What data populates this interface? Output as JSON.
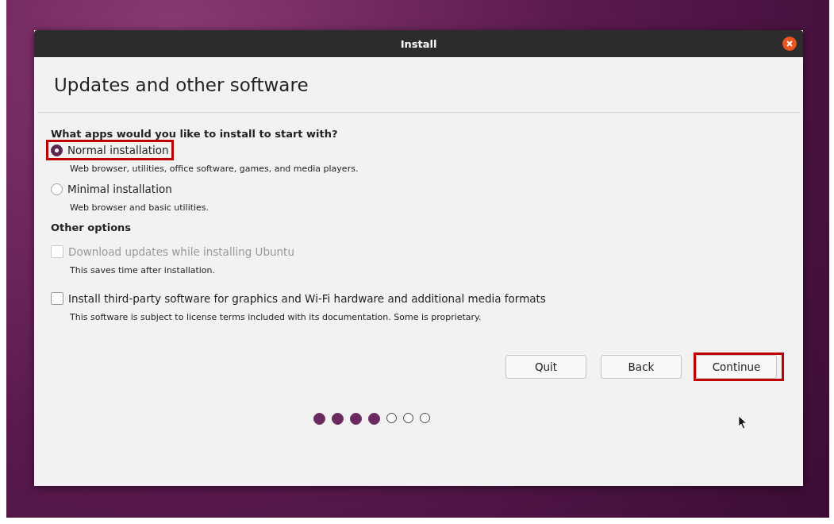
{
  "window": {
    "title": "Install"
  },
  "heading": "Updates and other software",
  "question": "What apps would you like to install to start with?",
  "install_options": [
    {
      "label": "Normal installation",
      "description": "Web browser, utilities, office software, games, and media players.",
      "selected": true,
      "highlighted": true
    },
    {
      "label": "Minimal installation",
      "description": "Web browser and basic utilities.",
      "selected": false,
      "highlighted": false
    }
  ],
  "other_heading": "Other options",
  "other_options": [
    {
      "label": "Download updates while installing Ubuntu",
      "description": "This saves time after installation.",
      "checked": false,
      "disabled": true
    },
    {
      "label": "Install third-party software for graphics and Wi-Fi hardware and additional media formats",
      "description": "This software is subject to license terms included with its documentation. Some is proprietary.",
      "checked": false,
      "disabled": false
    }
  ],
  "buttons": [
    {
      "label": "Quit",
      "highlighted": false
    },
    {
      "label": "Back",
      "highlighted": false
    },
    {
      "label": "Continue",
      "highlighted": true
    }
  ],
  "progress": [
    {
      "done": true
    },
    {
      "done": true
    },
    {
      "done": true
    },
    {
      "done": true
    },
    {
      "done": false
    },
    {
      "done": false
    },
    {
      "done": false
    }
  ]
}
